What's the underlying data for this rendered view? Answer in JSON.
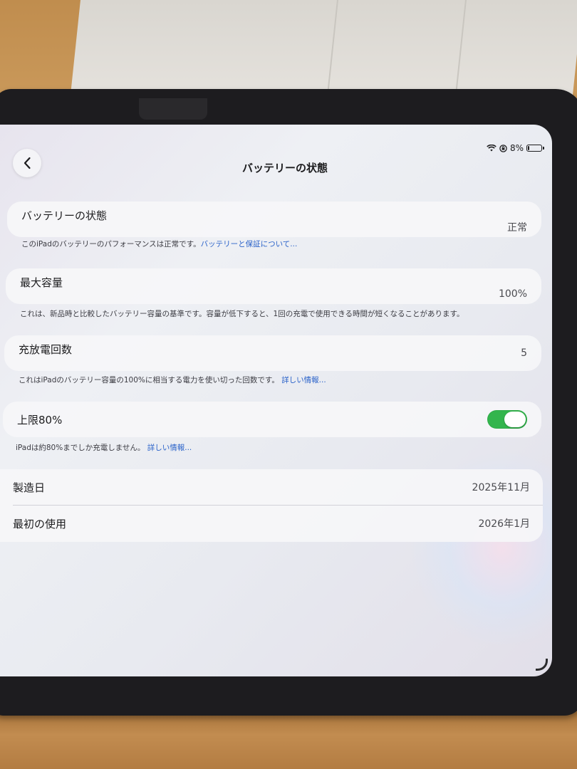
{
  "status_bar": {
    "battery_percent": "8%",
    "wifi_icon": "wifi-icon",
    "lock_icon": "orientation-lock-icon"
  },
  "nav": {
    "back_icon": "chevron-left-icon",
    "title": "バッテリーの状態"
  },
  "battery_health": {
    "label": "バッテリーの状態",
    "value": "正常",
    "footnote": "このiPadのバッテリーのパフォーマンスは正常です。",
    "footnote_link": "バッテリーと保証について..."
  },
  "max_capacity": {
    "label": "最大容量",
    "value": "100%",
    "footnote": "これは、新品時と比較したバッテリー容量の基準です。容量が低下すると、1回の充電で使用できる時間が短くなることがあります。"
  },
  "cycle_count": {
    "label": "充放電回数",
    "value": "5",
    "footnote": "これはiPadのバッテリー容量の100%に相当する電力を使い切った回数です。",
    "footnote_link": "詳しい情報..."
  },
  "limit_80": {
    "label": "上限80%",
    "toggle_on": true,
    "footnote": "iPadは約80%までしか充電しません。",
    "footnote_link": "詳しい情報..."
  },
  "info": {
    "manufacture_label": "製造日",
    "manufacture_value": "2025年11月",
    "first_use_label": "最初の使用",
    "first_use_value": "2026年1月"
  },
  "colors": {
    "accent_link": "#2a62c9",
    "toggle_on": "#33b54d"
  }
}
